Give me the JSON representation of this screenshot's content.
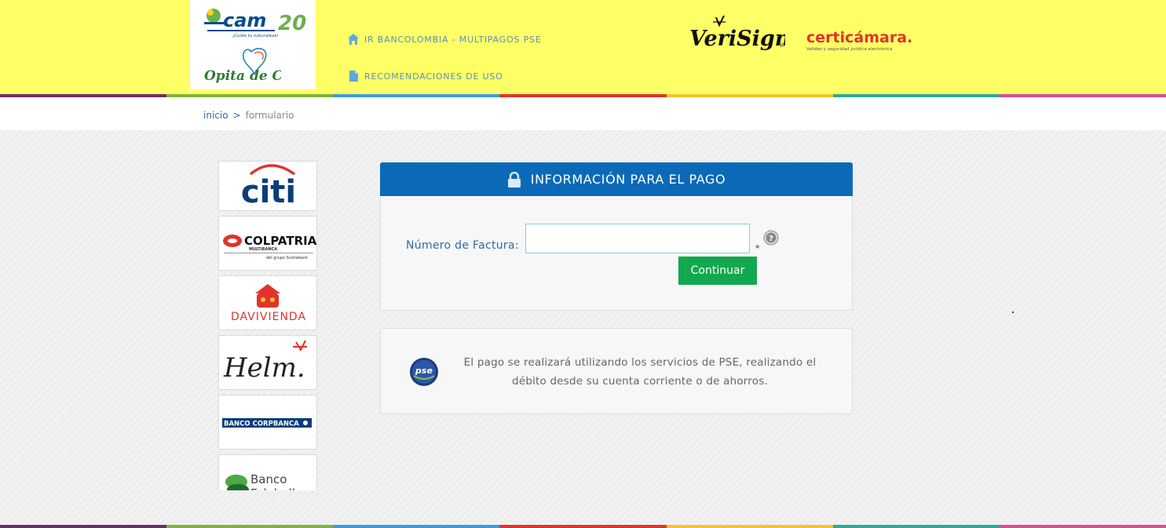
{
  "header": {
    "logo_cam_text": "cam",
    "logo_cam_number": "20",
    "logo_cam_slogan": "¡Cuida tu naturaleza!",
    "logo_opita_text": "Opita de Corazón",
    "nav": [
      {
        "label": "IR BANCOLOMBIA - MULTIPAGOS PSE",
        "icon": "home-icon"
      },
      {
        "label": "RECOMENDACIONES DE USO",
        "icon": "document-icon"
      }
    ],
    "verisign_text": "VeriSign",
    "certicamara_text": "certicámara.",
    "certicamara_tagline": "Validez y seguridad jurídica electrónica"
  },
  "colors": {
    "header_bg": "#ffff66",
    "panel_blue": "#0b6ab8",
    "button_green": "#12a84f",
    "link_blue": "#2b6ca8",
    "stripe": [
      "#6d2c6b",
      "#7fb33b",
      "#3b9be0",
      "#e0342b",
      "#f4c430",
      "#2aa9a0",
      "#d94f8f"
    ]
  },
  "breadcrumb": {
    "home": "inicio",
    "separator": ">",
    "current": "formulario"
  },
  "banks": [
    {
      "name": "citi"
    },
    {
      "name": "COLPATRIA",
      "sub": "MULTIBANCA",
      "group": "del grupo Scotiabank"
    },
    {
      "name": "DAVIVIENDA"
    },
    {
      "name": "Helm."
    },
    {
      "name": "BANCO CORPBANCA"
    },
    {
      "name": "Banco Falabella"
    }
  ],
  "payment": {
    "title": "INFORMACIÓN PARA EL PAGO",
    "field_label": "Número de Factura:",
    "field_value": "",
    "required_mark": "*",
    "button_label": "Continuar"
  },
  "info": {
    "pse_logo_text": "pse",
    "message": "El pago se realizará utilizando los servicios de PSE, realizando el débito desde su cuenta corriente o de ahorros."
  }
}
